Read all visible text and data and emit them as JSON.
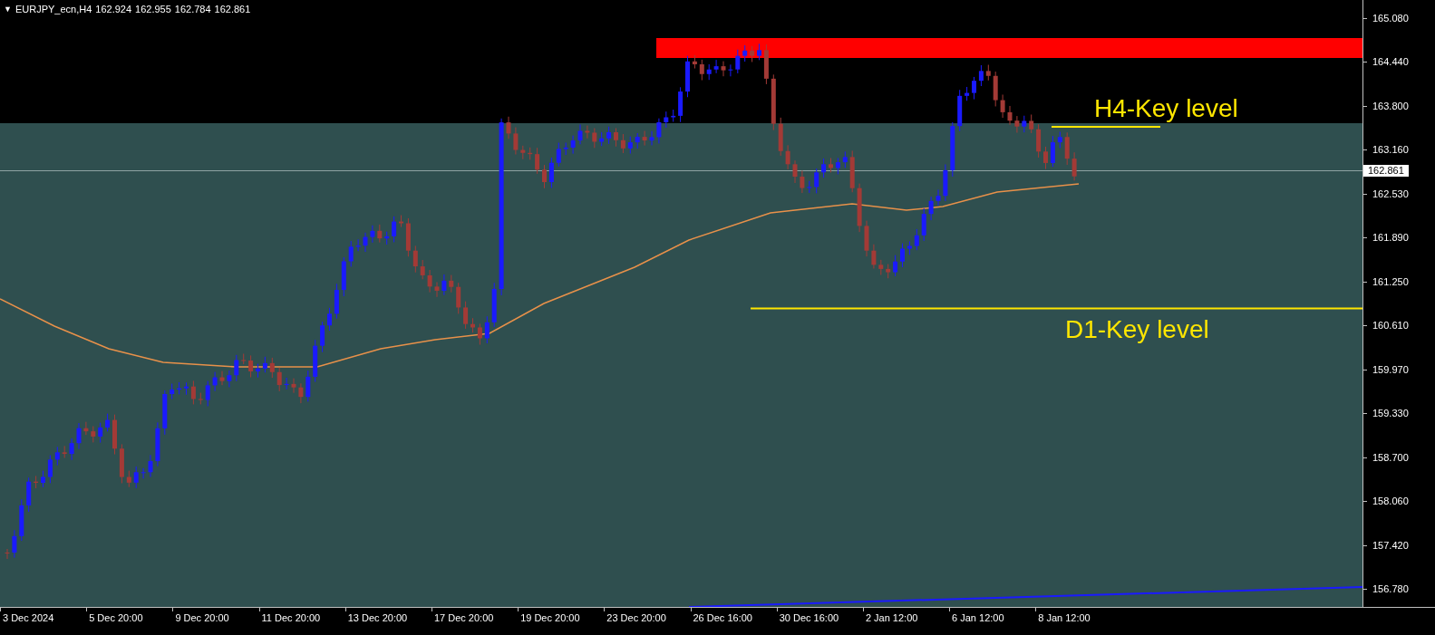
{
  "chart": {
    "menu_caret": "▼",
    "title": "EURJPY_ecn,H4",
    "ohlc": [
      "162.924",
      "162.955",
      "162.784",
      "162.861"
    ]
  },
  "annotations": [
    {
      "text": "H4-Key level"
    },
    {
      "text": "D1-Key level"
    }
  ],
  "price_axis": {
    "labels": [
      "165.080",
      "164.440",
      "163.800",
      "163.160",
      "162.530",
      "161.890",
      "161.250",
      "160.610",
      "159.970",
      "159.330",
      "158.700",
      "158.060",
      "157.420",
      "156.780"
    ],
    "current_price": "162.861"
  },
  "time_axis": {
    "labels": [
      "3 Dec 2024",
      "5 Dec 20:00",
      "9 Dec 20:00",
      "11 Dec 20:00",
      "13 Dec 20:00",
      "17 Dec 20:00",
      "19 Dec 20:00",
      "23 Dec 20:00",
      "26 Dec 16:00",
      "30 Dec 16:00",
      "2 Jan 12:00",
      "6 Jan 12:00",
      "8 Jan 12:00"
    ]
  }
}
